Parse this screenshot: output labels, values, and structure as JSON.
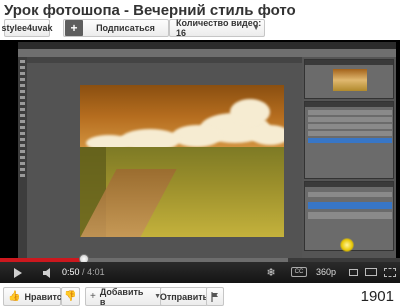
{
  "video": {
    "title": "Урок фотошопа - Вечерний стиль фото",
    "views": "1901"
  },
  "channel": {
    "username": "stylee4uvak",
    "subscribe_label": "Подписаться",
    "plus_symbol": "+",
    "video_count_label": "Количество видео: 16"
  },
  "player": {
    "current_time": "0:50",
    "separator": "/",
    "duration": "4:01",
    "quality": "360p",
    "cc_label": "CC",
    "progress_fraction": 0.21,
    "buffered_fraction": 0.72
  },
  "actions": {
    "like_label": "Нравится",
    "add_label": "Добавить в",
    "share_label": "Отправить"
  },
  "icons": {
    "like": "thumbs-up-icon",
    "dislike": "thumbs-down-icon",
    "add": "plus-icon",
    "flag": "flag-icon",
    "play": "play-icon",
    "volume": "volume-icon",
    "settings": "snowflake-icon",
    "chevron": "chevron-down-icon"
  },
  "colors": {
    "progress": "#cc181e",
    "background": "#ffffff"
  }
}
